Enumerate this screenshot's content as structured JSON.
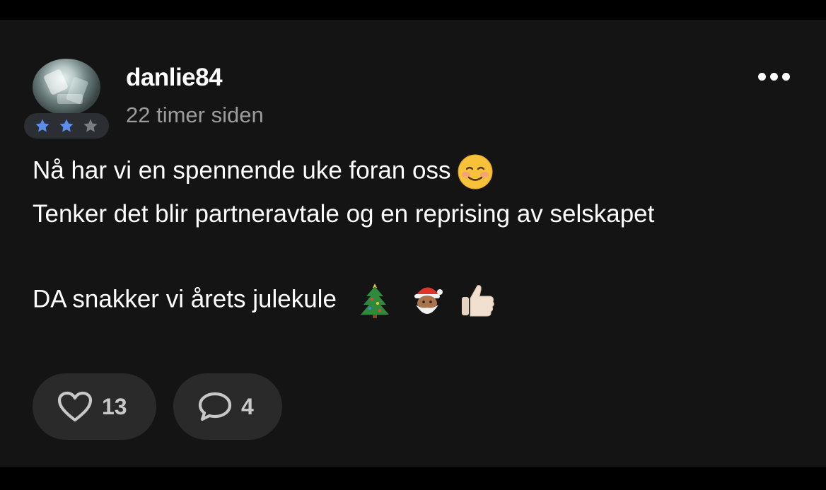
{
  "post": {
    "username": "danlie84",
    "timestamp": "22 timer siden",
    "rating": {
      "filled": 2,
      "total": 3
    },
    "lines": [
      "Nå har vi en spennende uke foran oss",
      "Tenker det blir partneravtale og en reprising av selskapet",
      "DA snakker vi årets julekule"
    ],
    "emojis": [
      "smiling-face-icon",
      "christmas-tree-icon",
      "santa-icon",
      "thumbs-up-icon"
    ]
  },
  "actions": {
    "like_count": "13",
    "comment_count": "4"
  },
  "colors": {
    "background": "#141414",
    "star_active": "#5b8def",
    "star_inactive": "#7a7d82",
    "pill": "#2a2a2a"
  }
}
